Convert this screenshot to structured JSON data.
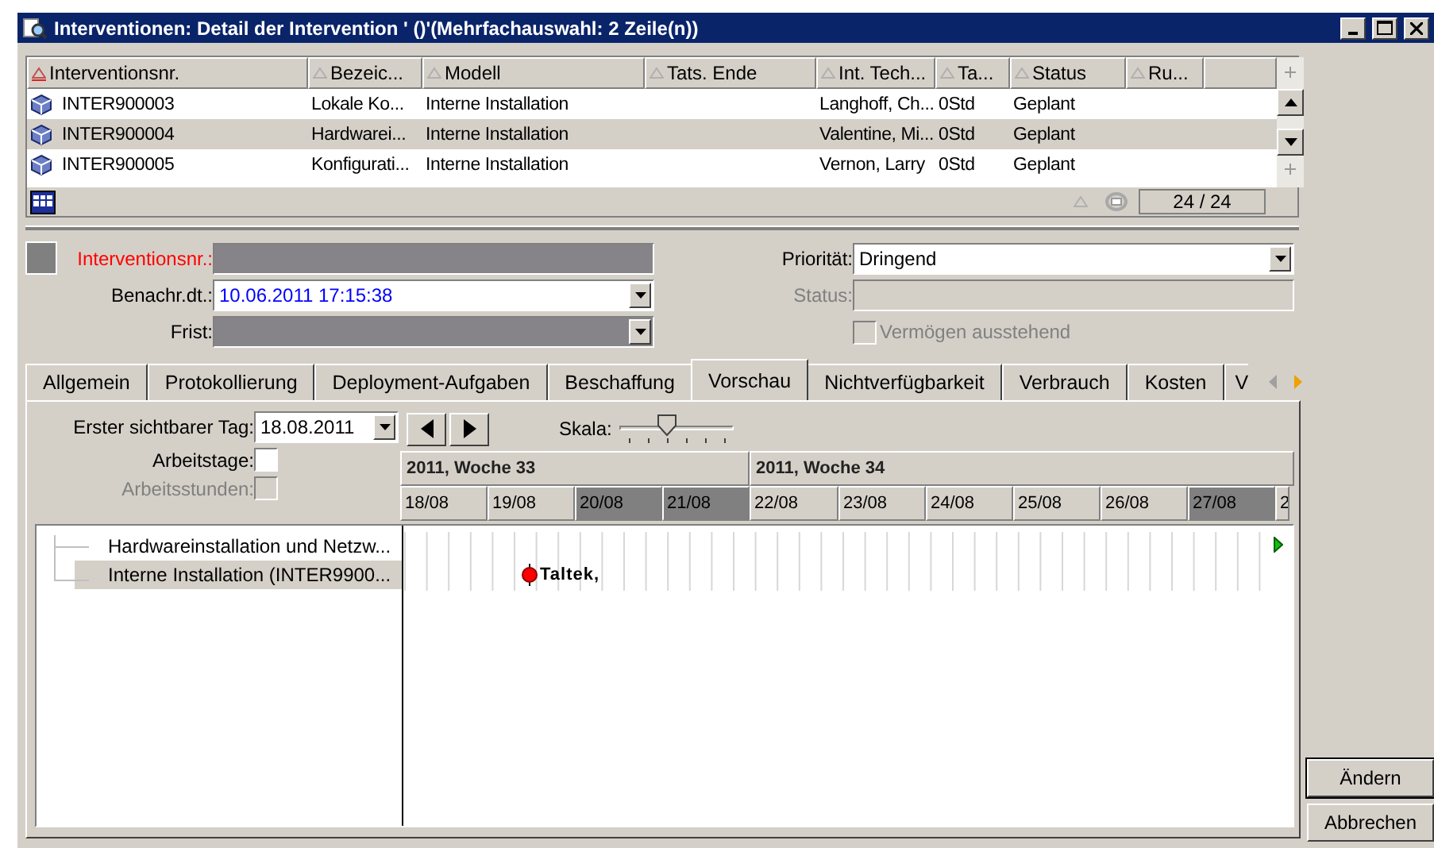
{
  "window": {
    "title": "Interventionen: Detail der Intervention ' ()'(Mehrfachauswahl: 2 Zeile(n))"
  },
  "table": {
    "columns": [
      {
        "label": "Interventionsnr.",
        "sorted": true
      },
      {
        "label": "Bezeic...",
        "sorted": false
      },
      {
        "label": "Modell",
        "sorted": false
      },
      {
        "label": "Tats. Ende",
        "sorted": false
      },
      {
        "label": "Int. Tech...",
        "sorted": false
      },
      {
        "label": "Ta...",
        "sorted": false
      },
      {
        "label": "Status",
        "sorted": false
      },
      {
        "label": "Ru...",
        "sorted": false
      }
    ],
    "rows": [
      {
        "cells": [
          "INTER900003",
          "Lokale Ko...",
          "Interne Installation",
          "",
          "Langhoff, Ch...",
          "0Std",
          "Geplant",
          ""
        ],
        "selected": false
      },
      {
        "cells": [
          "INTER900004",
          "Hardwarei...",
          "Interne Installation",
          "",
          "Valentine, Mi...",
          "0Std",
          "Geplant",
          ""
        ],
        "selected": true
      },
      {
        "cells": [
          "INTER900005",
          "Konfigurati...",
          "Interne Installation",
          "",
          "Vernon, Larry",
          "0Std",
          "Geplant",
          ""
        ],
        "selected": false
      }
    ],
    "count": "24 / 24"
  },
  "form": {
    "intervention_nr": {
      "label": "Interventionsnr.:"
    },
    "notification_date": {
      "label": "Benachr.dt.:",
      "value": "10.06.2011 17:15:38"
    },
    "deadline": {
      "label": "Frist:"
    },
    "priority": {
      "label": "Priorität:",
      "value": "Dringend"
    },
    "status": {
      "label": "Status:",
      "disabled": true
    },
    "assets_pending": {
      "label": "Vermögen ausstehend",
      "checked": false,
      "disabled": true
    }
  },
  "tabs": [
    {
      "label": "Allgemein",
      "selected": false
    },
    {
      "label": "Protokollierung",
      "selected": false
    },
    {
      "label": "Deployment-Aufgaben",
      "selected": false
    },
    {
      "label": "Beschaffung",
      "selected": false
    },
    {
      "label": "Vorschau",
      "selected": true
    },
    {
      "label": "Nichtverfügbarkeit",
      "selected": false
    },
    {
      "label": "Verbrauch",
      "selected": false
    },
    {
      "label": "Kosten",
      "selected": false
    },
    {
      "label": "V",
      "selected": false
    }
  ],
  "preview": {
    "first_day": {
      "label": "Erster sichtbarer Tag:",
      "value": "18.08.2011"
    },
    "scale": {
      "label": "Skala:",
      "level": 0.4
    },
    "workdays": {
      "label": "Arbeitstage:",
      "checked": false,
      "disabled": false
    },
    "workhours": {
      "label": "Arbeitsstunden:",
      "checked": false,
      "disabled": true
    },
    "weeks": [
      "2011, Woche 33",
      "2011, Woche 34"
    ],
    "days": [
      {
        "label": "18/08",
        "weekend": false
      },
      {
        "label": "19/08",
        "weekend": false
      },
      {
        "label": "20/08",
        "weekend": true
      },
      {
        "label": "21/08",
        "weekend": true
      },
      {
        "label": "22/08",
        "weekend": false
      },
      {
        "label": "23/08",
        "weekend": false
      },
      {
        "label": "24/08",
        "weekend": false
      },
      {
        "label": "25/08",
        "weekend": false
      },
      {
        "label": "26/08",
        "weekend": false
      },
      {
        "label": "27/08",
        "weekend": true
      },
      {
        "label": "2",
        "weekend": false
      }
    ],
    "tree": [
      {
        "label": "Hardwareinstallation und Netzw...",
        "selected": false
      },
      {
        "label": "Interne Installation (INTER9900...",
        "selected": true
      }
    ],
    "milestone": {
      "label": "Taltek,"
    }
  },
  "buttons": [
    {
      "label": "Ändern",
      "default": true
    },
    {
      "label": "Abbrechen",
      "default": false
    }
  ]
}
